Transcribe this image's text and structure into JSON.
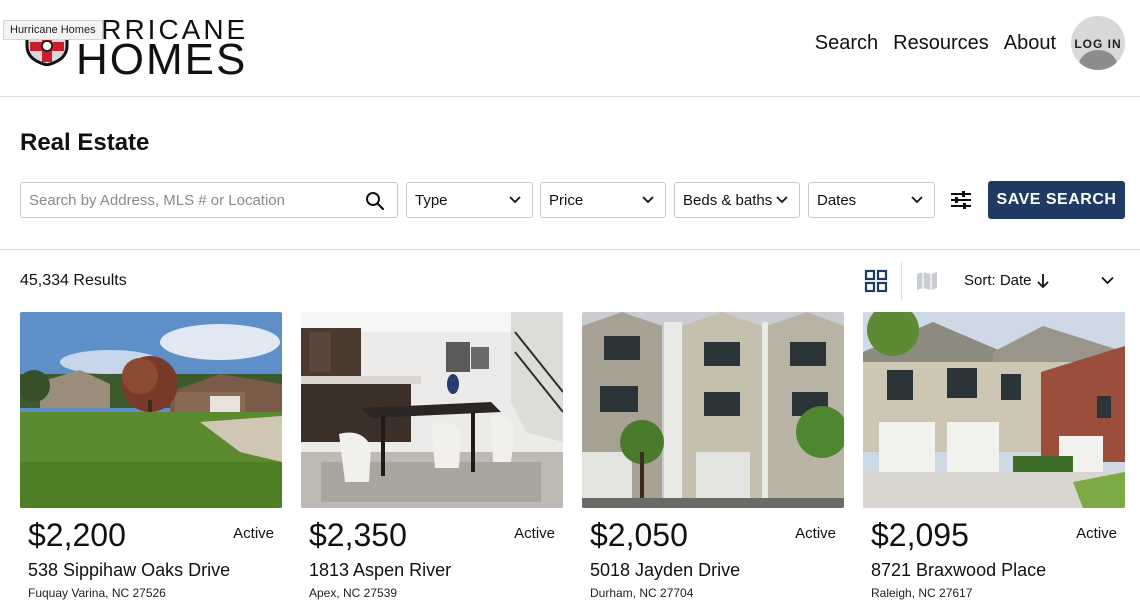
{
  "header": {
    "tooltip": "Hurricane Homes",
    "logo_top": "URRICANE",
    "logo_bottom": "HOMES",
    "nav": [
      "Search",
      "Resources",
      "About"
    ],
    "login_label": "LOG IN"
  },
  "page_title": "Real Estate",
  "filters": {
    "search_placeholder": "Search by Address, MLS # or Location",
    "type_label": "Type",
    "price_label": "Price",
    "beds_label": "Beds & baths",
    "dates_label": "Dates",
    "save_label": "SAVE SEARCH",
    "accent_color": "#1f3a63"
  },
  "results": {
    "count_text": "45,334 Results",
    "sort_label": "Sort: Date"
  },
  "listings": [
    {
      "price": "$2,200",
      "status": "Active",
      "street": "538 Sippihaw Oaks Drive",
      "city": "Fuquay Varina, NC 27526"
    },
    {
      "price": "$2,350",
      "status": "Active",
      "street": "1813 Aspen River",
      "city": "Apex, NC 27539"
    },
    {
      "price": "$2,050",
      "status": "Active",
      "street": "5018 Jayden Drive",
      "city": "Durham, NC 27704"
    },
    {
      "price": "$2,095",
      "status": "Active",
      "street": "8721 Braxwood Place",
      "city": "Raleigh, NC 27617"
    }
  ],
  "icons": [
    "shield-logo-icon",
    "search-icon",
    "chevron-down-icon",
    "filter-sliders-icon",
    "grid-view-icon",
    "map-view-icon",
    "arrow-down-icon"
  ]
}
